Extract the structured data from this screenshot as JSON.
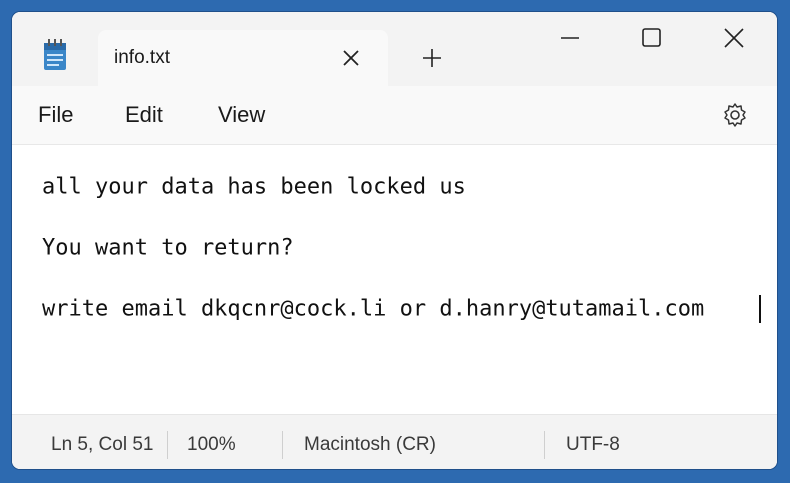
{
  "window": {
    "icons": {
      "app": "notepad-icon",
      "tab_close": "close-icon",
      "new_tab": "plus-icon",
      "minimize": "minimize-icon",
      "maximize": "maximize-icon",
      "close": "close-icon",
      "settings": "gear-icon"
    }
  },
  "tabs": [
    {
      "title": "info.txt"
    }
  ],
  "menu": {
    "file": "File",
    "edit": "Edit",
    "view": "View"
  },
  "editor": {
    "lines": [
      "all your data has been locked us",
      "You want to return?",
      "write email dkqcnr@cock.li or d.hanry@tutamail.com"
    ]
  },
  "status": {
    "position": "Ln 5, Col 51",
    "zoom": "100%",
    "line_ending": "Macintosh (CR)",
    "encoding": "UTF-8"
  },
  "colors": {
    "accent_background": "#2d6ab0"
  }
}
